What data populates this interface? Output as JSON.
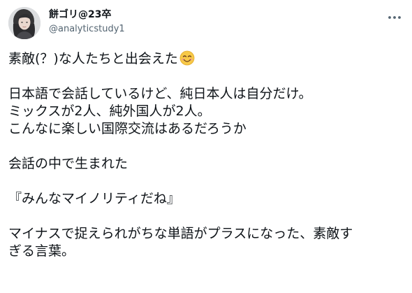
{
  "user": {
    "display_name": "餅ゴリ@23卒",
    "handle": "@analyticstudy1",
    "avatar_icon": "profile-photo"
  },
  "header": {
    "more_icon": "more-options-icon"
  },
  "tweet": {
    "line_1": "素敵(？)な人たちと出会えた",
    "line_1_emoji": "smiling-face-with-smiling-eyes",
    "line_2": "日本語で会話しているけど、純日本人は自分だけ。",
    "line_3": "ミックスが2人、純外国人が2人。",
    "line_4": "こんなに楽しい国際交流はあるだろうか",
    "line_5": "会話の中で生まれた",
    "line_6": "『みんなマイノリティだね』",
    "line_7": "マイナスで捉えられがちな単語がプラスになった、素敵す",
    "line_8": "ぎる言葉。"
  },
  "colors": {
    "text": "#0f1419",
    "secondary": "#536471",
    "background": "#ffffff"
  }
}
